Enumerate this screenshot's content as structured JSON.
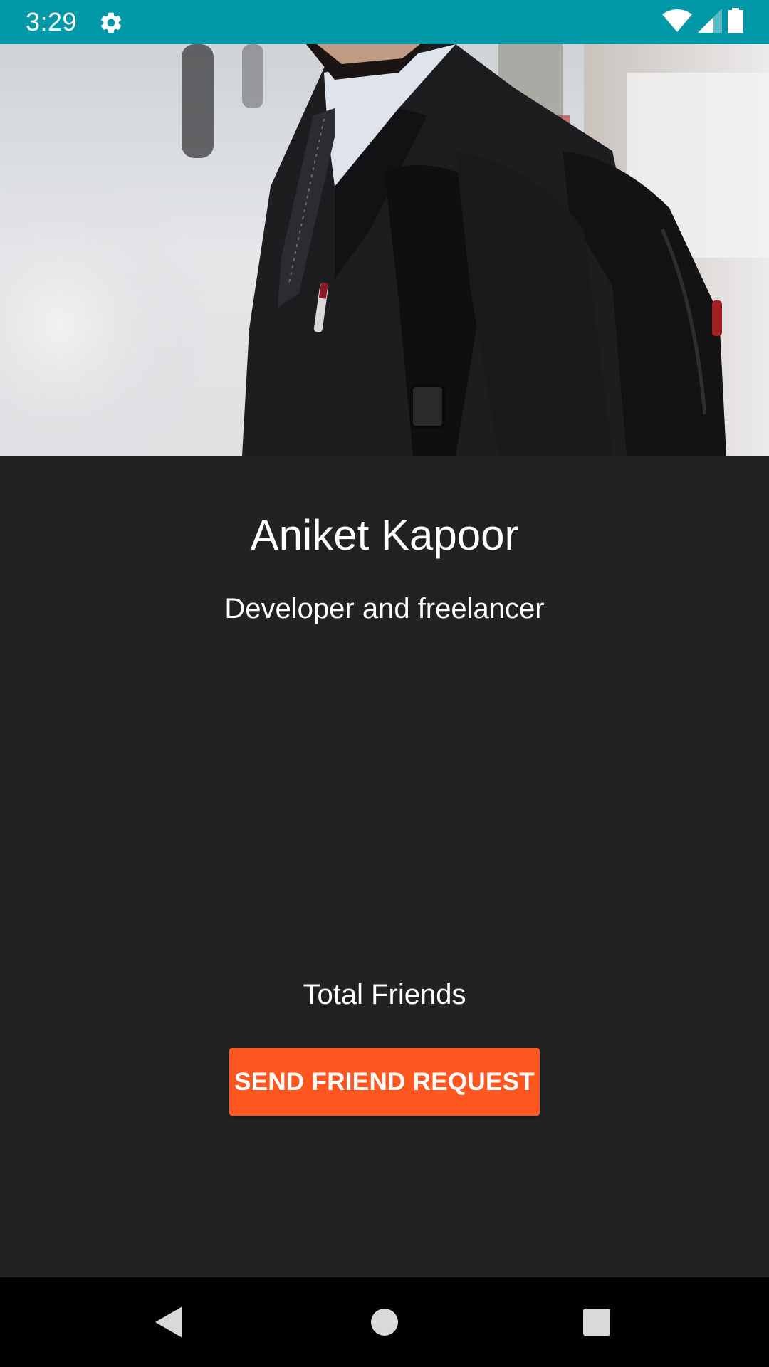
{
  "status_bar": {
    "time": "3:29",
    "background_color": "#0097A7",
    "icons": [
      "settings-icon",
      "wifi-icon",
      "cellular-signal-icon",
      "battery-icon"
    ]
  },
  "cover_photo": {
    "description_icon": "cover-photo"
  },
  "profile": {
    "name": "Aniket Kapoor",
    "status": "Developer and freelancer",
    "friends_label": "Total Friends"
  },
  "actions": {
    "send_request_label": "SEND FRIEND REQUEST",
    "button_color": "#FF5722"
  },
  "nav_bar": {
    "icons": [
      "back-icon",
      "home-icon",
      "recents-icon"
    ]
  },
  "colors": {
    "background": "#222222",
    "text": "#FFFFFF"
  }
}
